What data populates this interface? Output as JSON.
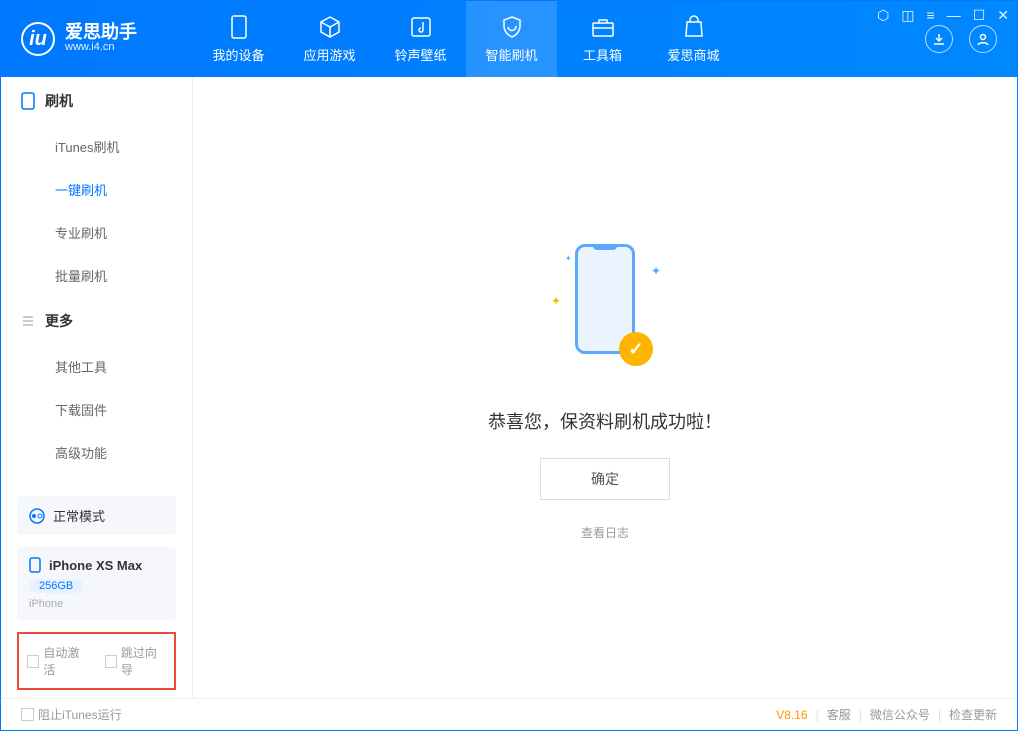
{
  "app": {
    "name": "爱思助手",
    "url": "www.i4.cn"
  },
  "tabs": [
    {
      "label": "我的设备"
    },
    {
      "label": "应用游戏"
    },
    {
      "label": "铃声壁纸"
    },
    {
      "label": "智能刷机"
    },
    {
      "label": "工具箱"
    },
    {
      "label": "爱思商城"
    }
  ],
  "sidebar": {
    "group1": {
      "title": "刷机",
      "items": [
        "iTunes刷机",
        "一键刷机",
        "专业刷机",
        "批量刷机"
      ]
    },
    "group2": {
      "title": "更多",
      "items": [
        "其他工具",
        "下载固件",
        "高级功能"
      ]
    }
  },
  "mode": {
    "label": "正常模式"
  },
  "device": {
    "name": "iPhone XS Max",
    "storage": "256GB",
    "type": "iPhone"
  },
  "checkboxes": {
    "auto_activate": "自动激活",
    "skip_guide": "跳过向导"
  },
  "main": {
    "success": "恭喜您，保资料刷机成功啦！",
    "ok": "确定",
    "view_log": "查看日志"
  },
  "footer": {
    "block_itunes": "阻止iTunes运行",
    "version": "V8.16",
    "link1": "客服",
    "link2": "微信公众号",
    "link3": "检查更新"
  }
}
